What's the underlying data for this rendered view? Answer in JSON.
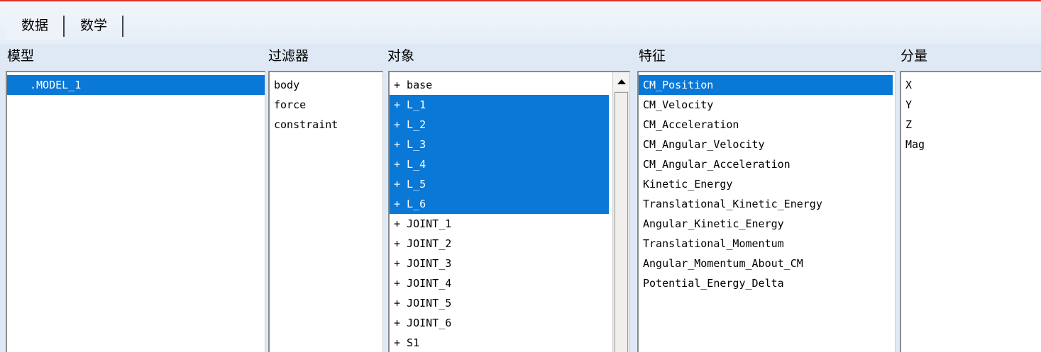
{
  "tabs": [
    "数据",
    "数学"
  ],
  "columns": {
    "model": {
      "header": "模型",
      "items": [
        ".MODEL_1"
      ],
      "selected": [
        0
      ]
    },
    "filter": {
      "header": "过滤器",
      "items": [
        "body",
        "force",
        "constraint"
      ],
      "selected": []
    },
    "object": {
      "header": "对象",
      "items": [
        "+ base",
        "+ L_1",
        "+ L_2",
        "+ L_3",
        "+ L_4",
        "+ L_5",
        "+ L_6",
        "+ JOINT_1",
        "+ JOINT_2",
        "+ JOINT_3",
        "+ JOINT_4",
        "+ JOINT_5",
        "+ JOINT_6",
        "+ S1"
      ],
      "selected": [
        1,
        2,
        3,
        4,
        5,
        6
      ]
    },
    "characteristic": {
      "header": "特征",
      "items": [
        "CM_Position",
        "CM_Velocity",
        "CM_Acceleration",
        "CM_Angular_Velocity",
        "CM_Angular_Acceleration",
        "Kinetic_Energy",
        "Translational_Kinetic_Energy",
        "Angular_Kinetic_Energy",
        "Translational_Momentum",
        "Angular_Momentum_About_CM",
        "Potential_Energy_Delta"
      ],
      "selected": [
        0
      ]
    },
    "component": {
      "header": "分量",
      "items": [
        "X",
        "Y",
        "Z",
        "Mag"
      ],
      "selected": []
    }
  },
  "colors": {
    "selection": "#0a78d7",
    "accent_line": "#e0302b"
  },
  "icons": {
    "scroll_up": "triangle-up-icon"
  }
}
